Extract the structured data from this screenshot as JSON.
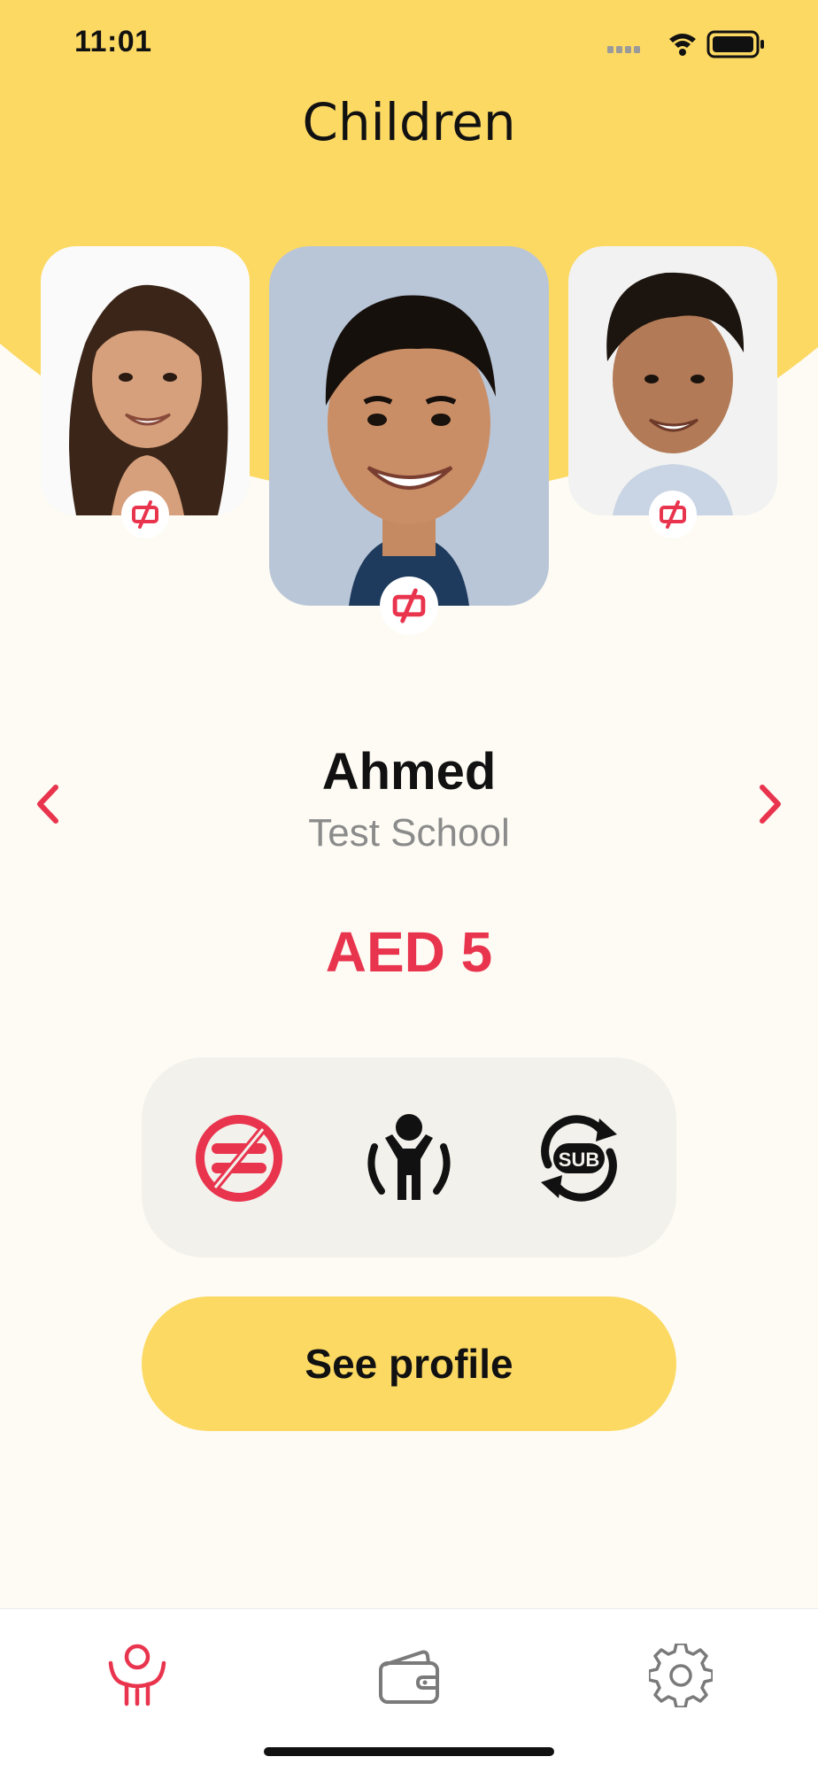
{
  "status_bar": {
    "time": "11:01"
  },
  "header": {
    "title": "Children"
  },
  "colors": {
    "accent": "#E9344E",
    "brand_yellow": "#FCD963",
    "background": "#FDFBF3",
    "panel": "#F2F1EC"
  },
  "children_carousel": {
    "items": [
      {
        "icon": "girl-photo",
        "badge_icon": "no-card-icon"
      },
      {
        "icon": "boy-photo",
        "badge_icon": "no-card-icon",
        "selected": true
      },
      {
        "icon": "boy-photo",
        "badge_icon": "no-card-icon"
      }
    ]
  },
  "selected_child": {
    "name": "Ahmed",
    "school": "Test School",
    "balance": "AED 5"
  },
  "actions": [
    {
      "icon": "blocked-food-icon"
    },
    {
      "icon": "child-icon"
    },
    {
      "icon": "subscription-icon"
    }
  ],
  "see_profile_label": "See profile",
  "tab_bar": {
    "tabs": [
      {
        "icon": "children-tab-icon",
        "active": true
      },
      {
        "icon": "wallet-tab-icon",
        "active": false
      },
      {
        "icon": "settings-tab-icon",
        "active": false
      }
    ]
  }
}
